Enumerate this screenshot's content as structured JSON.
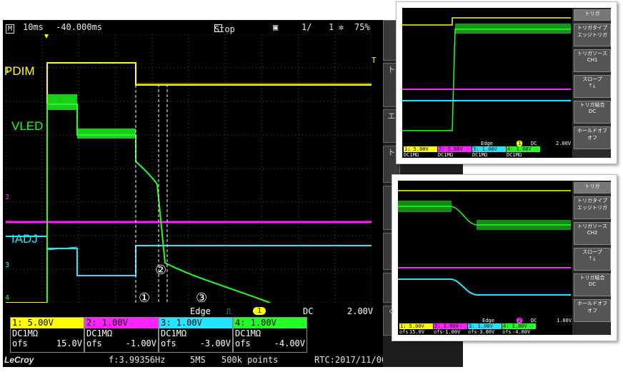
{
  "scope": {
    "status": {
      "mode_glyph": "M",
      "timebase": "10ms",
      "delay": "-40.000ms",
      "run_state": "Stop",
      "page": "1/",
      "page_total": "1",
      "battery": "75%"
    },
    "channel_labels": [
      "PDIM",
      "VLED",
      "IADJ"
    ],
    "channel_numbers": [
      "1",
      "2",
      "3",
      "4"
    ],
    "trigger_level_mark": "T",
    "annotations": [
      "①",
      "②",
      "③"
    ],
    "trigger": {
      "type": "Edge",
      "source": "1",
      "coupling": "DC",
      "level": "2.00V"
    },
    "channels": [
      {
        "header": "1: 5.00V",
        "coupling": "DC1MΩ",
        "ofs_label": "ofs",
        "ofs": "15.0V",
        "color": "#ffff00"
      },
      {
        "header": "2: 1.00V",
        "coupling": "DC1MΩ",
        "ofs_label": "ofs",
        "ofs": "-1.00V",
        "color": "#ff22ff"
      },
      {
        "header": "3: 1.00V",
        "coupling": "DC1MΩ",
        "ofs_label": "ofs",
        "ofs": "-3.00V",
        "color": "#22e6ff"
      },
      {
        "header": "4: 1.00V",
        "coupling": "DC1MΩ",
        "ofs_label": "ofs",
        "ofs": "-4.00V",
        "color": "#22ff22"
      }
    ],
    "bottom": {
      "brand": "LeCroy",
      "frequency": "f:3.99356Hz",
      "sample_rate": "5MS",
      "points": "500k points",
      "rtc": "RTC:2017/11/06 18:43:30"
    }
  },
  "inset1": {
    "menu": [
      "トリガ",
      "トリガタイプ",
      "エッジトリガ",
      "トリガソース",
      "CH1",
      "スロープ",
      "トリガ結合",
      "DC",
      "ホールドオフ",
      "オフ"
    ],
    "source_badge": "1",
    "trigger_line": {
      "type": "Edge",
      "coupling": "DC",
      "level": "2.00V"
    },
    "channels": [
      "1: 5.00V",
      "2: 1.00V",
      "3: 1.00V",
      "4: 1.00V"
    ],
    "coupling_row": [
      "DC1MΩ",
      "DC1MΩ",
      "DC1MΩ",
      "DC1MΩ"
    ],
    "ofs_row": [
      "ofs",
      "15.0V",
      "ofs",
      "-1.00V",
      "ofs",
      "-3.00V",
      "ofs",
      "-4.00V"
    ]
  },
  "inset2": {
    "menu": [
      "トリガ",
      "トリガタイプ",
      "エッジトリガ",
      "トリガソース",
      "CH2",
      "スロープ",
      "トリガ結合",
      "DC",
      "ホールドオフ",
      "オフ"
    ],
    "source_badge": "2",
    "trigger_line": {
      "type": "Edge",
      "coupling": "DC",
      "level": "1.66V"
    },
    "channels": [
      "1: 5.00V",
      "2: 1.00V",
      "3: 1.00V",
      "4: 1.00V"
    ],
    "coupling_row": [
      "DC1MΩ",
      "DC1MΩ",
      "DC1MΩ",
      "DC1MΩ"
    ],
    "ofs_row": [
      "ofs",
      "15.0V",
      "ofs",
      "-1.00V",
      "ofs",
      "-3.00V",
      "ofs",
      "-4.00V"
    ]
  },
  "colors": {
    "ch1": "#ffff00",
    "ch2": "#ff22ff",
    "ch3": "#22e6ff",
    "ch4": "#22ff22",
    "grid": "#555555"
  }
}
